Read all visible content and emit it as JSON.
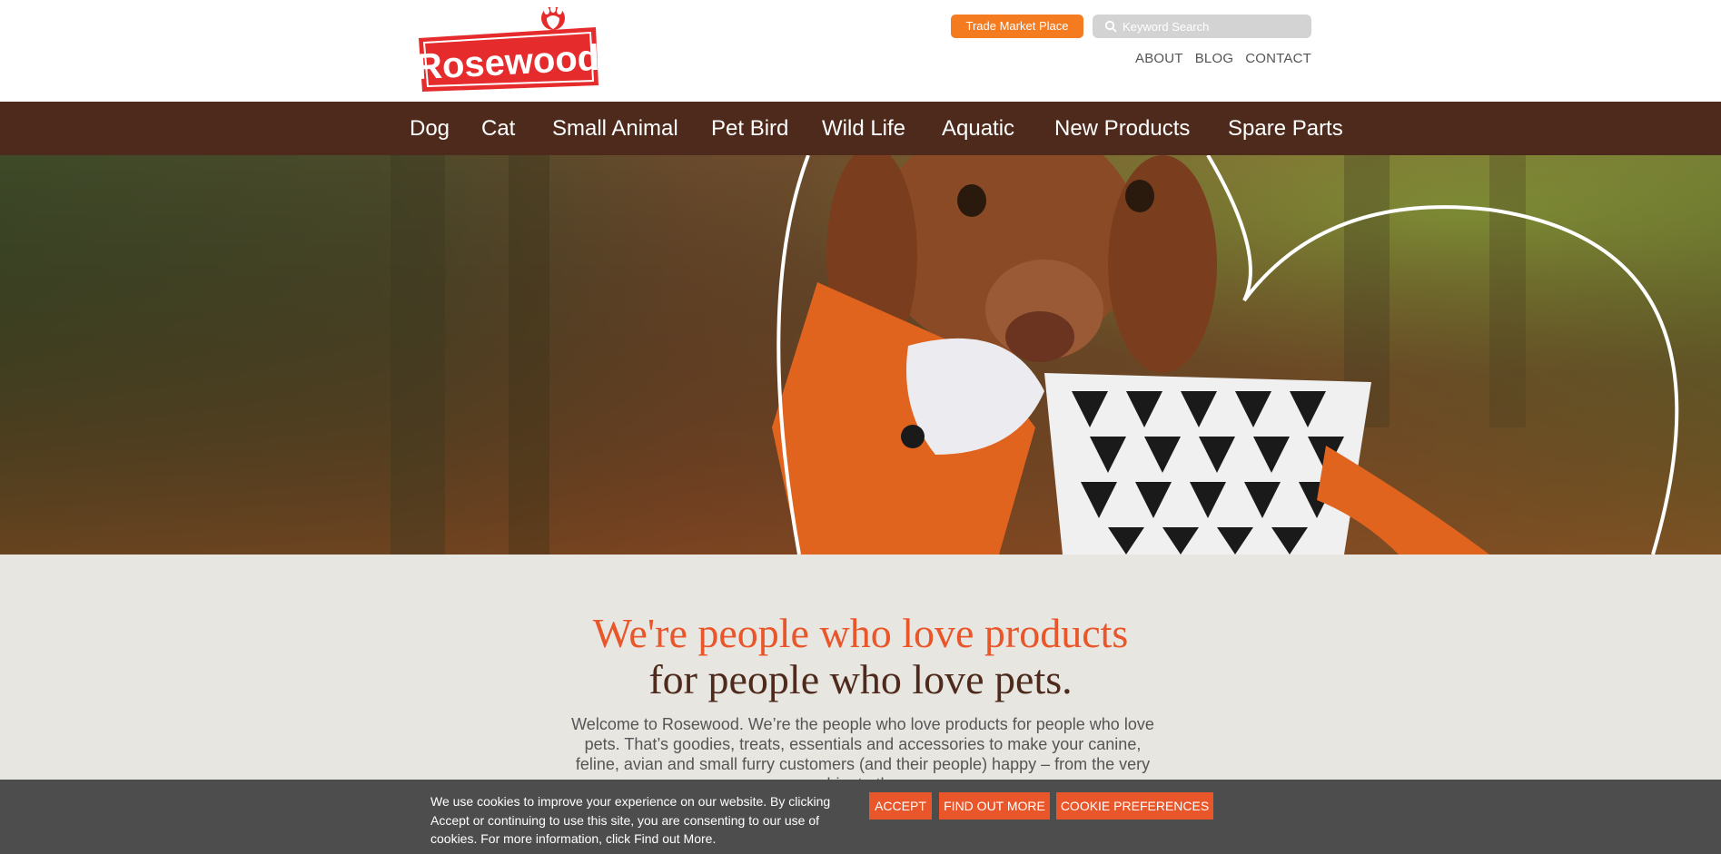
{
  "header": {
    "logo_text": "Rosewood",
    "trade_label": "Trade Market Place",
    "search_placeholder": "Keyword Search",
    "links": [
      "ABOUT",
      "BLOG",
      "CONTACT"
    ]
  },
  "nav": {
    "items": [
      "Dog",
      "Cat",
      "Small Animal",
      "Pet Bird",
      "Wild Life",
      "Aquatic",
      "New Products",
      "Spare Parts"
    ]
  },
  "intro": {
    "headline_1": "We're people who love products",
    "headline_2": "for people who love pets.",
    "body": "Welcome to Rosewood. We’re the people who love products for people who love pets. That’s goodies, treats, essentials and accessories to make your canine, feline, avian and small furry customers (and their people) happy – from the very big, to the"
  },
  "cookie": {
    "text": "We use cookies to improve your experience on our website. By clicking Accept or continuing to use this site, you are consenting to our use of cookies. For more information, click Find out More.",
    "accept": "ACCEPT",
    "find_out_more": "FIND OUT MORE",
    "preferences": "COOKIE PREFERENCES"
  },
  "colors": {
    "brand_red": "#e52b2b",
    "orange": "#f47b20",
    "nav_brown": "#4e2a1c",
    "accent_orange": "#e8562a"
  }
}
